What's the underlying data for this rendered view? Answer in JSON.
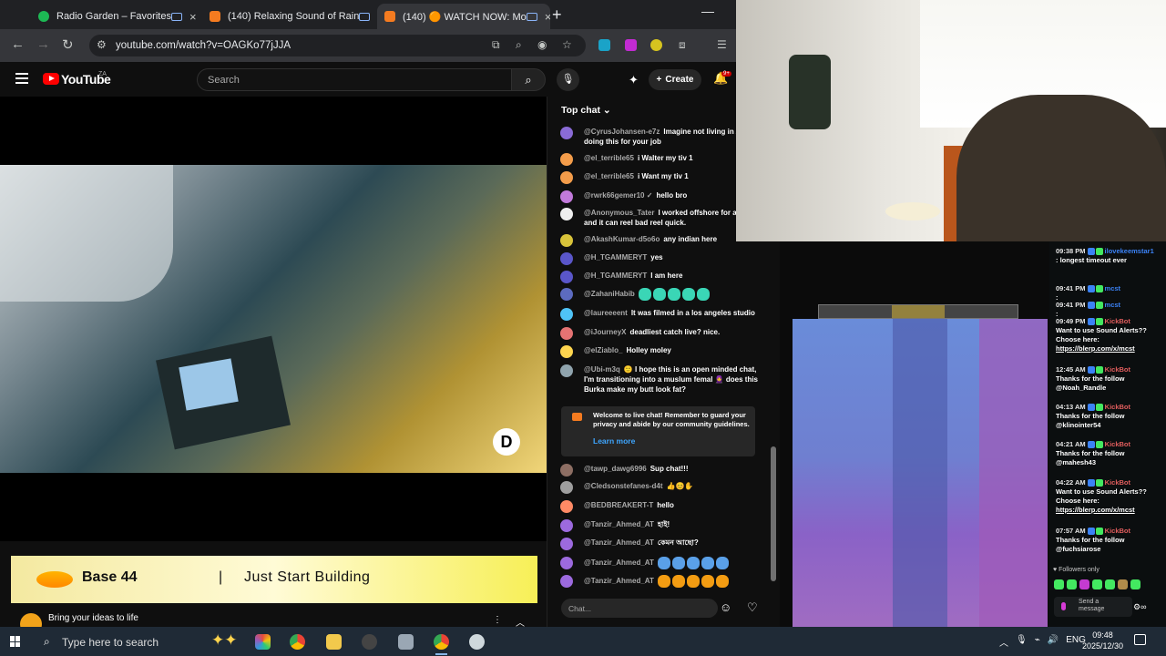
{
  "browser": {
    "tabs": [
      {
        "title": "Radio Garden – Favorites",
        "favicon_color": "#1db954"
      },
      {
        "title": "(140) Relaxing Sound of Rain",
        "favicon_color": "#f47b20"
      },
      {
        "title": "(140) 🟠 WATCH NOW: Mo",
        "favicon_color": "#f47b20"
      }
    ],
    "new_tab": "+",
    "minimize": "—",
    "url": "youtube.com/watch?v=OAGKo77jJJA"
  },
  "youtube": {
    "logo_text": "YouTube",
    "country": "ZA",
    "search_placeholder": "Search",
    "create_label": "Create",
    "notification_count": "9+",
    "video_watermark": "D"
  },
  "ad": {
    "brand": "Base 44",
    "separator": "|",
    "tagline": "Just Start Building",
    "title": "Bring your ideas to life"
  },
  "chat": {
    "header": "Top chat",
    "messages": [
      {
        "author": "@CyrusJohansen-e7z",
        "text": "Imagine not living in A and doing this for your job",
        "avatar": "#8a6bd6"
      },
      {
        "author": "@el_terrible65",
        "text": "i Walter my tiv 1",
        "avatar": "#f39c4a"
      },
      {
        "author": "@el_terrible65",
        "text": "i Want my tiv 1",
        "avatar": "#f39c4a"
      },
      {
        "author": "@rwrk66gemer10 ✓",
        "text": "hello bro",
        "avatar": "#c27adb"
      },
      {
        "author": "@Anonymous_Tater",
        "text": "I worked offshore for a f years and it can reel bad reel quick.",
        "avatar": "#eeeeee"
      },
      {
        "author": "@AkashKumar-d5o6o",
        "text": "any indian here",
        "avatar": "#d8c33a"
      },
      {
        "author": "@H_TGAMMERYT",
        "text": "yes",
        "avatar": "#5a56c9"
      },
      {
        "author": "@H_TGAMMERYT",
        "text": "I am here",
        "avatar": "#5a56c9"
      },
      {
        "author": "@ZahaniHabib",
        "text": "",
        "avatar": "#5c6bc0",
        "emotes": 5
      },
      {
        "author": "@laureeeent",
        "text": "It was filmed in a los angeles studio",
        "avatar": "#4fc3f7"
      },
      {
        "author": "@iJourneyX",
        "text": "deadliest catch live? nice.",
        "avatar": "#e57373"
      },
      {
        "author": "@elZiablo_",
        "text": "Holley moley",
        "avatar": "#ffd54f"
      },
      {
        "author": "@Ubi-m3q",
        "text": "🙂 I hope this is an open minded chat, I'm transitioning into a muslum femal 🧕 does this Burka make my butt look fat?",
        "avatar": "#90a4ae"
      }
    ],
    "welcome_text": "Welcome to live chat! Remember to guard your privacy and abide by our community guidelines.",
    "learn_more": "Learn more",
    "messages2": [
      {
        "author": "@tawp_dawg6996",
        "text": "Sup chat!!!",
        "avatar": "#8d6e63"
      },
      {
        "author": "@Cledsonstefanes-d4t",
        "text": "👍😊✋",
        "avatar": "#9e9e9e"
      },
      {
        "author": "@BEDBREAKERT-T",
        "text": "hello",
        "avatar": "#ff8a65"
      },
      {
        "author": "@Tanzir_Ahmed_AT",
        "text": "হাই!",
        "avatar": "#9c6ade"
      },
      {
        "author": "@Tanzir_Ahmed_AT",
        "text": "কেমন আছো?",
        "avatar": "#9c6ade"
      },
      {
        "author": "@Tanzir_Ahmed_AT",
        "text": "",
        "avatar": "#9c6ade",
        "emotes": 5,
        "emote_color": "#5aa0e8"
      },
      {
        "author": "@Tanzir_Ahmed_AT",
        "text": "",
        "avatar": "#9c6ade",
        "emotes": 5,
        "emote_color": "#f39c12"
      }
    ],
    "input_placeholder": "Chat..."
  },
  "kick_chat": {
    "messages": [
      {
        "time": "09:38 PM",
        "name": "ilovekeemstar1",
        "name_color": "#3b82f6",
        "text": ": longest timeout ever"
      },
      {
        "time": "09:41 PM",
        "name": "mcst",
        "name_color": "#3b82f6",
        "text": ":"
      },
      {
        "time": "09:41 PM",
        "name": "mcst",
        "name_color": "#3b82f6",
        "text": ":"
      },
      {
        "time": "09:49 PM",
        "name": "KickBot",
        "name_color": "#e05d5d",
        "text": "Want to use Sound Alerts?? Choose here:",
        "link": "https://blerp.com/x/mcst"
      },
      {
        "time": "12:45 AM",
        "name": "KickBot",
        "name_color": "#e05d5d",
        "text": "Thanks for the follow @Noah_Randle"
      },
      {
        "time": "04:13 AM",
        "name": "KickBot",
        "name_color": "#e05d5d",
        "text": "Thanks for the follow @klinointer54"
      },
      {
        "time": "04:21 AM",
        "name": "KickBot",
        "name_color": "#e05d5d",
        "text": "Thanks for the follow @mahesh43"
      },
      {
        "time": "04:22 AM",
        "name": "KickBot",
        "name_color": "#e05d5d",
        "text": "Want to use Sound Alerts?? Choose here:",
        "link": "https://blerp.com/x/mcst"
      },
      {
        "time": "07:57 AM",
        "name": "KickBot",
        "name_color": "#e05d5d",
        "text": "Thanks for the follow @fuchsiarose"
      }
    ],
    "followers_only": "♥ Followers only",
    "input_placeholder": "Send a message"
  },
  "taskbar": {
    "search_placeholder": "Type here to search",
    "language": "ENG",
    "time": "09:48",
    "date": "2025/12/30"
  }
}
